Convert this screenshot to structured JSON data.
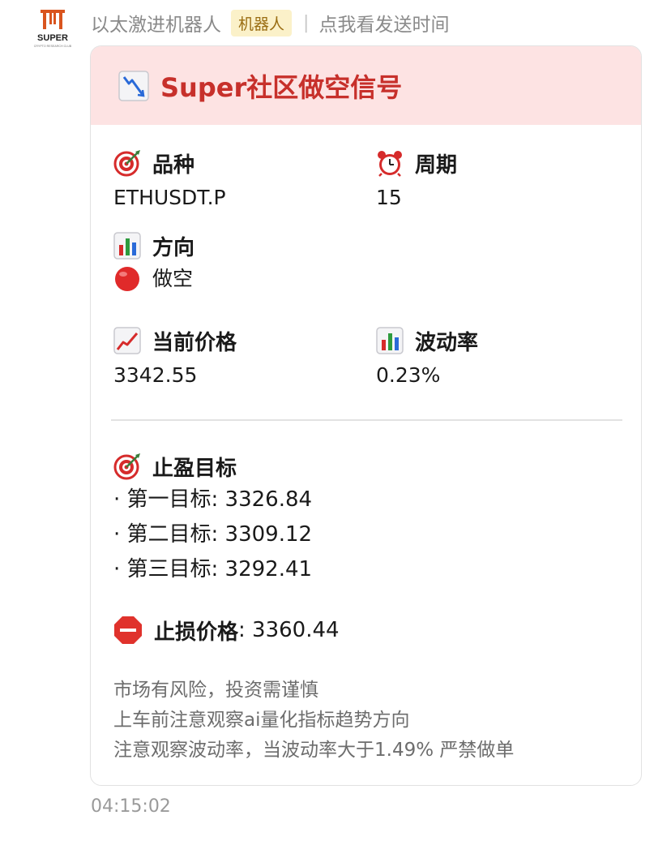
{
  "sender": {
    "name": "以太激进机器人",
    "badge": "机器人",
    "separator": "|",
    "show_time_link": "点我看发送时间",
    "avatar_text": "SUPER",
    "avatar_subtext": "CRYPTO RESEARCH CLUB",
    "avatar_icon": "super-pi-logo",
    "avatar_color": "#d9541e"
  },
  "card": {
    "header_icon": "chart-decreasing-icon",
    "title": "Super社区做空信号",
    "header_bg": "#fde3e3",
    "title_color": "#c7302b",
    "fields": {
      "symbol": {
        "icon": "direct-hit-icon",
        "label": "品种",
        "value": "ETHUSDT.P"
      },
      "period": {
        "icon": "alarm-clock-icon",
        "label": "周期",
        "value": "15"
      },
      "direction": {
        "icon": "bar-chart-icon",
        "label": "方向",
        "value_icon": "red-circle-icon",
        "value": "做空"
      },
      "price": {
        "icon": "chart-increasing-icon",
        "label": "当前价格",
        "value": "3342.55"
      },
      "volatility": {
        "icon": "bar-chart-icon",
        "label": "波动率",
        "value": "0.23%"
      }
    },
    "take_profit": {
      "icon": "direct-hit-icon",
      "label": "止盈目标",
      "targets": [
        "· 第一目标: 3326.84",
        "· 第二目标: 3309.12",
        "· 第三目标: 3292.41"
      ]
    },
    "stop_loss": {
      "icon": "stop-sign-icon",
      "label": "止损价格",
      "value": ": 3360.44"
    },
    "disclaimer": [
      "市场有风险，投资需谨慎",
      "上车前注意观察ai量化指标趋势方向",
      "注意观察波动率，当波动率大于1.49% 严禁做单"
    ]
  },
  "timestamp": "04:15:02"
}
